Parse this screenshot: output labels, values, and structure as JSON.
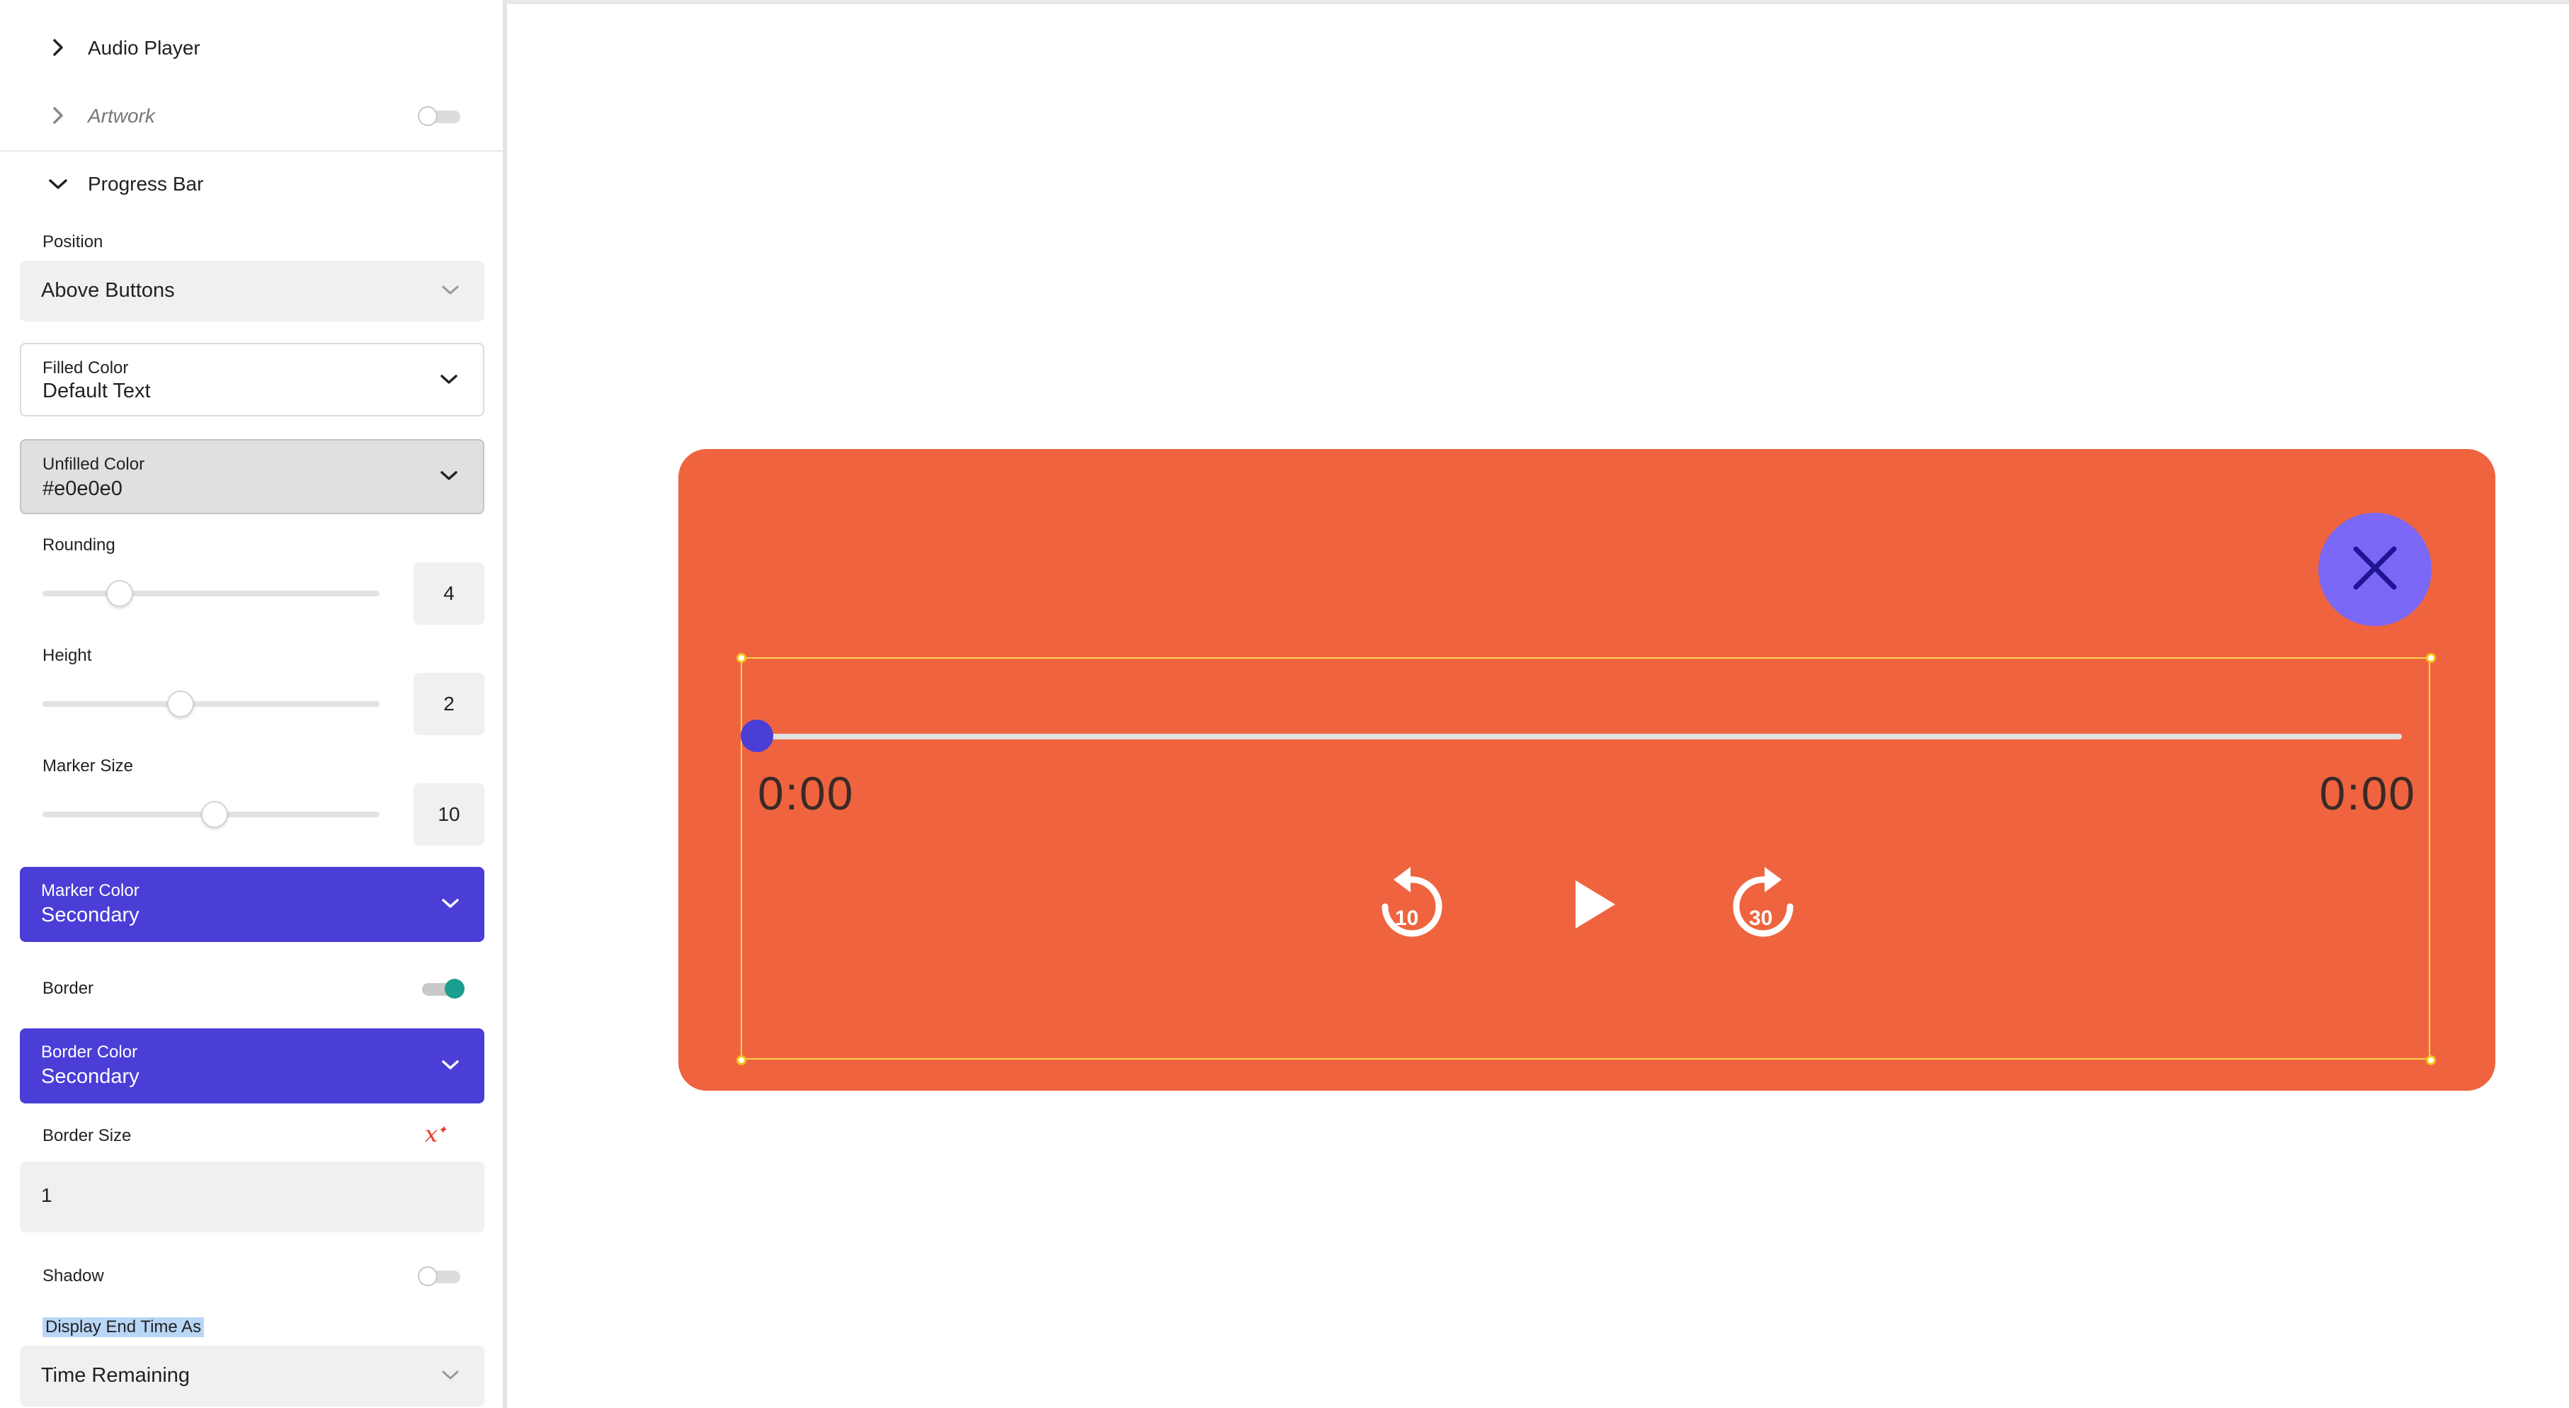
{
  "sidebar": {
    "audio_player_label": "Audio Player",
    "artwork_label": "Artwork",
    "progress_bar_label": "Progress Bar",
    "position": {
      "label": "Position",
      "value": "Above Buttons"
    },
    "filled_color": {
      "label": "Filled Color",
      "value": "Default Text"
    },
    "unfilled_color": {
      "label": "Unfilled Color",
      "value": "#e0e0e0"
    },
    "rounding": {
      "label": "Rounding",
      "value": "4",
      "slider_fraction": 0.23
    },
    "height": {
      "label": "Height",
      "value": "2",
      "slider_fraction": 0.41
    },
    "marker_size": {
      "label": "Marker Size",
      "value": "10",
      "slider_fraction": 0.51
    },
    "marker_color": {
      "label": "Marker Color",
      "value": "Secondary"
    },
    "border": {
      "label": "Border",
      "enabled": true
    },
    "border_color": {
      "label": "Border Color",
      "value": "Secondary"
    },
    "border_size": {
      "label": "Border Size",
      "value": "1",
      "formula_icon": "x"
    },
    "shadow": {
      "label": "Shadow",
      "enabled": false
    },
    "display_end_time": {
      "label": "Display End Time As",
      "value": "Time Remaining"
    }
  },
  "player": {
    "current_time": "0:00",
    "end_time": "0:00",
    "rewind_seconds": "10",
    "forward_seconds": "30",
    "progress_fraction": 0
  },
  "colors": {
    "player_bg": "#ef643f",
    "secondary": "#4b3ed6",
    "close_bg": "#7b68f6",
    "toggle_on": "#1a9e8f"
  }
}
